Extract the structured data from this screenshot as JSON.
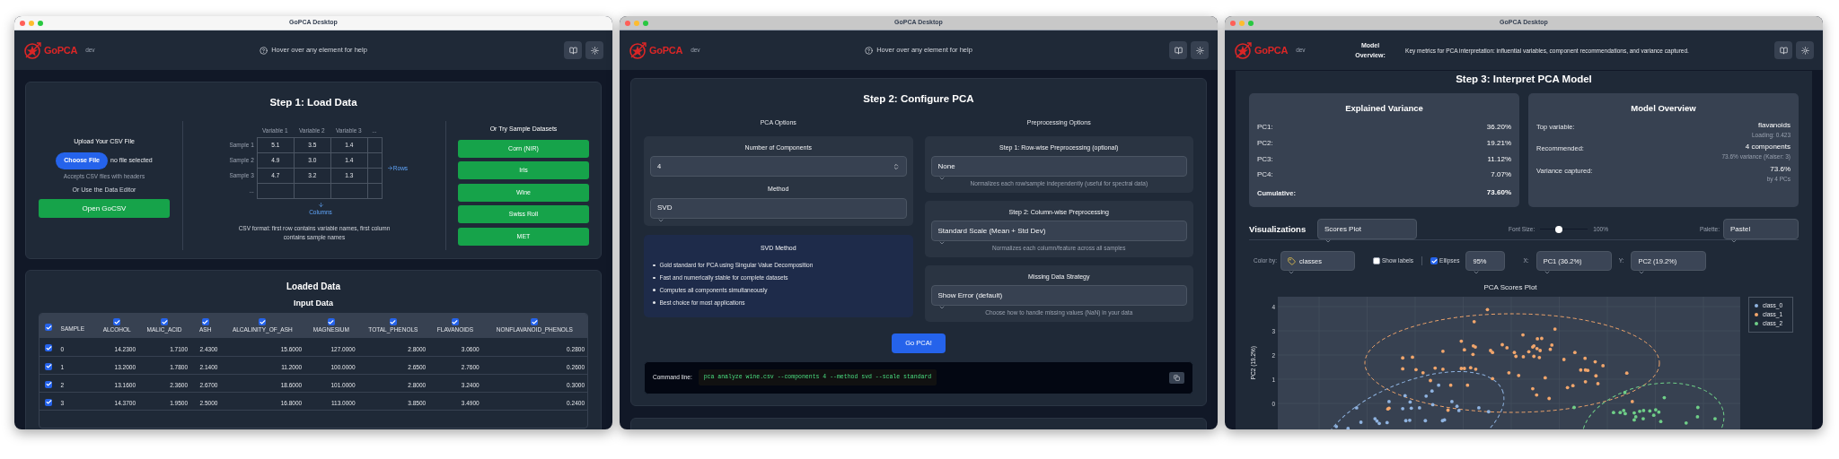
{
  "windows": [
    {
      "kind": "load",
      "active": true,
      "title": "GoPCA Desktop",
      "header": {
        "logo": "GoPCA",
        "badge": "dev",
        "help": {
          "kind": "hint",
          "text": "Hover over any element for help"
        }
      },
      "step_title": "Step 1: Load Data",
      "upload": {
        "title": "Upload Your CSV File",
        "button": "Choose File",
        "file_status": "no file selected",
        "hint": "Accepts CSV files with headers",
        "alt": "Or Use the Data Editor",
        "editor_button": "Open GoCSV"
      },
      "format": {
        "columns": [
          "Variable 1",
          "Variable 2",
          "Variable 3",
          "..."
        ],
        "rows": [
          {
            "label": "Sample 1",
            "cells": [
              "5.1",
              "3.5",
              "1.4"
            ]
          },
          {
            "label": "Sample 2",
            "cells": [
              "4.9",
              "3.0",
              "1.4"
            ]
          },
          {
            "label": "Sample 3",
            "cells": [
              "4.7",
              "3.2",
              "1.3"
            ]
          },
          {
            "label": "...",
            "cells": []
          }
        ],
        "rows_label": "Rows",
        "columns_label": "Columns",
        "caption": "CSV format: first row contains variable names, first column contains sample names"
      },
      "samples": {
        "title": "Or Try Sample Datasets",
        "datasets": [
          "Corn (NIR)",
          "Iris",
          "Wine",
          "Swiss Roll",
          "MET"
        ]
      },
      "loaded": {
        "title": "Loaded Data",
        "subtitle": "Input Data",
        "all_checked": true,
        "columns": [
          {
            "kind": "label",
            "label": "SAMPLE"
          },
          {
            "kind": "variable",
            "label": "ALCOHOL",
            "checked": true
          },
          {
            "kind": "variable",
            "label": "MALIC_ACID",
            "checked": true
          },
          {
            "kind": "variable",
            "label": "ASH",
            "checked": true
          },
          {
            "kind": "variable",
            "label": "ALCALINITY_OF_ASH",
            "checked": true
          },
          {
            "kind": "variable",
            "label": "MAGNESIUM",
            "checked": true
          },
          {
            "kind": "variable",
            "label": "TOTAL_PHENOLS",
            "checked": true
          },
          {
            "kind": "variable",
            "label": "FLAVANOIDS",
            "checked": true
          },
          {
            "kind": "variable",
            "label": "NONFLAVANOID_PHENOLS",
            "checked": true
          }
        ],
        "rows": [
          {
            "checked": true,
            "cells": [
              "0",
              "14.2300",
              "1.7100",
              "2.4300",
              "15.6000",
              "127.0000",
              "2.8000",
              "3.0600",
              "0.2800"
            ]
          },
          {
            "checked": true,
            "cells": [
              "1",
              "13.2000",
              "1.7800",
              "2.1400",
              "11.2000",
              "100.0000",
              "2.6500",
              "2.7600",
              "0.2600"
            ]
          },
          {
            "checked": true,
            "cells": [
              "2",
              "13.1600",
              "2.3600",
              "2.6700",
              "18.6000",
              "101.0000",
              "2.8000",
              "3.2400",
              "0.3000"
            ]
          },
          {
            "checked": true,
            "cells": [
              "3",
              "14.3700",
              "1.9500",
              "2.5000",
              "16.8000",
              "113.0000",
              "3.8500",
              "3.4900",
              "0.2400"
            ]
          }
        ]
      }
    },
    {
      "kind": "configure",
      "active": false,
      "title": "GoPCA Desktop",
      "header": {
        "logo": "GoPCA",
        "badge": "dev",
        "help": {
          "kind": "hint",
          "text": "Hover over any element for help"
        }
      },
      "step_title": "Step 2: Configure PCA",
      "pca": {
        "title": "PCA Options",
        "components_label": "Number of Components",
        "components": "4",
        "method_label": "Method",
        "method": "SVD",
        "info": {
          "title": "SVD Method",
          "bullets": [
            "Gold standard for PCA using Singular Value Decomposition",
            "Fast and numerically stable for complete datasets",
            "Computes all components simultaneously",
            "Best choice for most applications"
          ]
        }
      },
      "preprocessing": {
        "title": "Preprocessing Options",
        "steps": [
          {
            "label": "Step 1: Row-wise Preprocessing (optional)",
            "value": "None",
            "hint": "Normalizes each row/sample independently (useful for spectral data)"
          },
          {
            "label": "Step 2: Column-wise Preprocessing",
            "value": "Standard Scale (Mean + Std Dev)",
            "hint": "Normalizes each column/feature across all samples"
          },
          {
            "label": "Missing Data Strategy",
            "value": "Show Error (default)",
            "hint": "Choose how to handle missing values (NaN) in your data"
          }
        ]
      },
      "run_button": "Go PCA!",
      "command": {
        "label": "Command line:",
        "code": "pca analyze wine.csv --components 4 --method svd --scale standard"
      }
    },
    {
      "kind": "interpret",
      "active": false,
      "title": "GoPCA Desktop",
      "header": {
        "logo": "GoPCA",
        "badge": "dev",
        "help": {
          "kind": "tooltip",
          "title": "Model Overview:",
          "text": "Key metrics for PCA interpretation: influential variables, component recommendations, and variance captured."
        }
      },
      "step_title": "Step 3: Interpret PCA Model",
      "variance": {
        "title": "Explained Variance",
        "rows": [
          {
            "label": "PC1:",
            "value": "36.20%"
          },
          {
            "label": "PC2:",
            "value": "19.21%"
          },
          {
            "label": "PC3:",
            "value": "11.12%"
          },
          {
            "label": "PC4:",
            "value": "7.07%"
          }
        ],
        "total": {
          "label": "Cumulative:",
          "value": "73.60%"
        }
      },
      "overview": {
        "title": "Model Overview",
        "rows": [
          {
            "label": "Top variable:",
            "value": "flavanoids",
            "note": "Loading: 0.423"
          },
          {
            "label": "Recommended:",
            "value": "4 components",
            "note": "73.6% variance (Kaiser: 3)"
          },
          {
            "label": "Variance captured:",
            "value": "73.6%",
            "note": "by 4 PCs"
          }
        ]
      },
      "viz": {
        "title": "Visualizations",
        "plot_type": "Scores Plot",
        "font_label": "Font Size:",
        "font_size": {
          "level": 0.4
        },
        "font_value": "100%",
        "palette_label": "Palette:",
        "palette": "Pastel"
      },
      "controls": {
        "color_label": "Color by:",
        "color_by": "classes",
        "show_labels": {
          "label": "Show labels",
          "checked": false
        },
        "ellipses": {
          "label": "Ellipses",
          "checked": true
        },
        "confidence": "95%",
        "x_label": "X:",
        "x": "PC1 (36.2%)",
        "y_label": "Y:",
        "y": "PC2 (19.2%)"
      },
      "plot": {
        "title": "PCA Scores Plot",
        "ylabel": "PC2 (19.2%)",
        "yticks": [
          "4",
          "3",
          "2",
          "1",
          "0"
        ],
        "legend": [
          {
            "label": "class_0",
            "color": "#8fb3e0"
          },
          {
            "label": "class_1",
            "color": "#f2a66c"
          },
          {
            "label": "class_2",
            "color": "#6fcf88"
          }
        ]
      }
    }
  ]
}
